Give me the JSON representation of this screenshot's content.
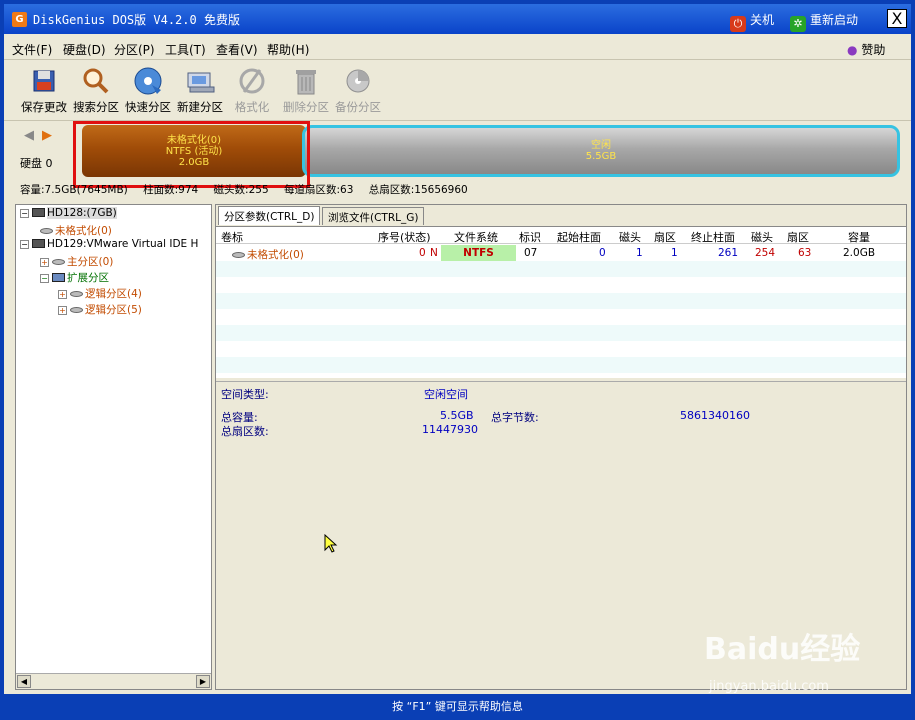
{
  "window": {
    "title": "DiskGenius DOS版 V4.2.0 免费版",
    "shutdown_label": "关机",
    "restart_label": "重新启动",
    "close_label": "X"
  },
  "menu": [
    "文件(F)",
    "硬盘(D)",
    "分区(P)",
    "工具(T)",
    "查看(V)",
    "帮助(H)"
  ],
  "menu_right": "赞助",
  "toolbar": [
    {
      "label": "保存更改",
      "icon": "save-icon",
      "enabled": true
    },
    {
      "label": "搜索分区",
      "icon": "magnifier-icon",
      "enabled": true
    },
    {
      "label": "快速分区",
      "icon": "disc-icon",
      "enabled": true
    },
    {
      "label": "新建分区",
      "icon": "new-partition-icon",
      "enabled": true
    },
    {
      "label": "格式化",
      "icon": "format-icon",
      "enabled": false
    },
    {
      "label": "删除分区",
      "icon": "trash-icon",
      "enabled": false
    },
    {
      "label": "备份分区",
      "icon": "backup-icon",
      "enabled": false
    }
  ],
  "diskbar": {
    "disk_label": "硬盘 0",
    "partition_used": {
      "name": "未格式化(0)",
      "fs": "NTFS (活动)",
      "size": "2.0GB"
    },
    "partition_free": {
      "name": "空闲",
      "size": "5.5GB"
    },
    "info": [
      "容量:7.5GB(7645MB)",
      "柱面数:974",
      "磁头数:255",
      "每道扇区数:63",
      "总扇区数:15656960"
    ]
  },
  "tree": {
    "hd0": "HD128:(7GB)",
    "hd0_part": "未格式化(0)",
    "hd1": "HD129:VMware Virtual IDE H",
    "primary": "主分区(0)",
    "extended": "扩展分区",
    "logical4": "逻辑分区(4)",
    "logical5": "逻辑分区(5)"
  },
  "tabs": [
    "分区参数(CTRL_D)",
    "浏览文件(CTRL_G)"
  ],
  "table": {
    "headers": [
      "卷标",
      "序号(状态)",
      "文件系统",
      "标识",
      "起始柱面",
      "磁头",
      "扇区",
      "终止柱面",
      "磁头",
      "扇区",
      "容量"
    ],
    "rows": [
      {
        "label": "未格式化(0)",
        "seq": "0",
        "status": "N",
        "fs": "NTFS",
        "id": "07",
        "start_cyl": "0",
        "start_head": "1",
        "start_sec": "1",
        "end_cyl": "261",
        "end_head": "254",
        "end_sec": "63",
        "size": "2.0GB"
      }
    ]
  },
  "detail": {
    "space_type_label": "空间类型:",
    "space_type_value": "空闲空间",
    "total_cap_label": "总容量:",
    "total_cap_value": "5.5GB",
    "total_bytes_label": "总字节数:",
    "total_bytes_value": "5861340160",
    "total_sectors_label": "总扇区数:",
    "total_sectors_value": "11447930"
  },
  "statusbar": "按 “F1” 键可显示帮助信息",
  "watermark": {
    "brand": "Baidu经验",
    "url": "jingyan.baidu.com"
  }
}
